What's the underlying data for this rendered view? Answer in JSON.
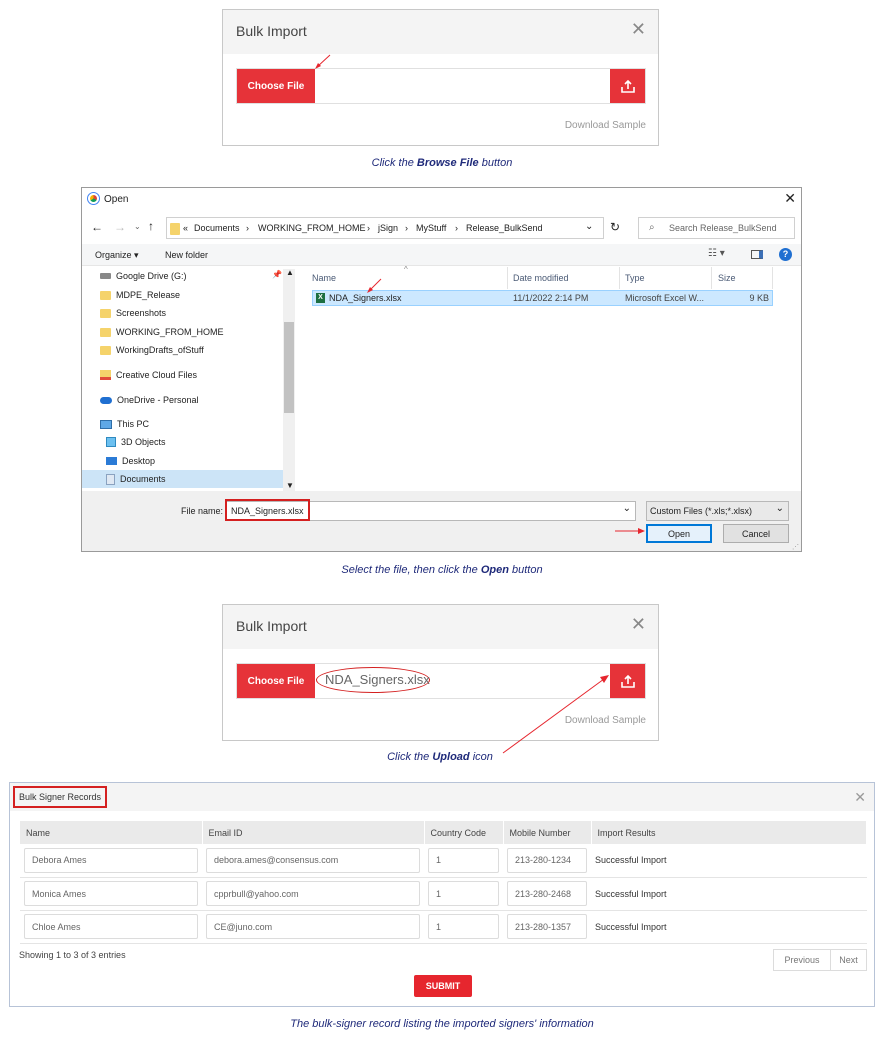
{
  "panel1": {
    "title": "Bulk Import",
    "choose_file_label": "Choose File",
    "download_sample": "Download Sample",
    "caption_pre": "Click the ",
    "caption_bold": "Browse File",
    "caption_post": " button"
  },
  "open_dialog": {
    "title": "Open",
    "breadcrumb": [
      "Documents",
      "WORKING_FROM_HOME",
      "jSign",
      "MyStuff",
      "Release_BulkSend"
    ],
    "search_placeholder": "Search Release_BulkSend",
    "organize_label": "Organize",
    "new_folder_label": "New folder",
    "nav_items": [
      {
        "label": "Google Drive (G:)",
        "icon": "drive-icon"
      },
      {
        "label": "MDPE_Release",
        "icon": "folder-icon"
      },
      {
        "label": "Screenshots",
        "icon": "folder-icon"
      },
      {
        "label": "WORKING_FROM_HOME",
        "icon": "folder-icon"
      },
      {
        "label": "WorkingDrafts_ofStuff",
        "icon": "folder-icon"
      },
      {
        "label": "Creative Cloud Files",
        "icon": "creative-cloud-icon"
      },
      {
        "label": "OneDrive - Personal",
        "icon": "cloud-icon"
      },
      {
        "label": "This PC",
        "icon": "computer-icon"
      },
      {
        "label": "3D Objects",
        "icon": "cube-icon"
      },
      {
        "label": "Desktop",
        "icon": "desktop-icon"
      },
      {
        "label": "Documents",
        "icon": "documents-icon"
      }
    ],
    "columns": [
      "Name",
      "Date modified",
      "Type",
      "Size"
    ],
    "file": {
      "name": "NDA_Signers.xlsx",
      "date": "11/1/2022 2:14 PM",
      "type": "Microsoft Excel W...",
      "size": "9 KB"
    },
    "file_name_label": "File name:",
    "file_name_value": "NDA_Signers.xlsx",
    "file_type_filter": "Custom Files (*.xls;*.xlsx)",
    "open_label": "Open",
    "cancel_label": "Cancel",
    "caption_pre": "Select the file, then click the ",
    "caption_bold": "Open",
    "caption_post": " button"
  },
  "panel2": {
    "title": "Bulk Import",
    "choose_file_label": "Choose File",
    "file_name": "NDA_Signers.xlsx",
    "download_sample": "Download Sample",
    "caption_pre": "Click the ",
    "caption_bold": "Upload",
    "caption_post": " icon"
  },
  "records": {
    "title": "Bulk Signer Records",
    "columns": [
      "Name",
      "Email ID",
      "Country Code",
      "Mobile Number",
      "Import Results"
    ],
    "rows": [
      {
        "name": "Debora Ames",
        "email": "debora.ames@consensus.com",
        "code": "1",
        "mobile": "213-280-1234",
        "result": "Successful Import"
      },
      {
        "name": "Monica Ames",
        "email": "cpprbull@yahoo.com",
        "code": "1",
        "mobile": "213-280-2468",
        "result": "Successful Import"
      },
      {
        "name": "Chloe Ames",
        "email": "CE@juno.com",
        "code": "1",
        "mobile": "213-280-1357",
        "result": "Successful Import"
      }
    ],
    "showing": "Showing 1 to 3 of 3 entries",
    "previous": "Previous",
    "next": "Next",
    "submit": "SUBMIT",
    "caption": "The bulk-signer record listing the imported signers' information"
  },
  "colors": {
    "accent_red": "#e63339",
    "caption_blue": "#1f2a7a",
    "selection_blue": "#cce8ff"
  }
}
